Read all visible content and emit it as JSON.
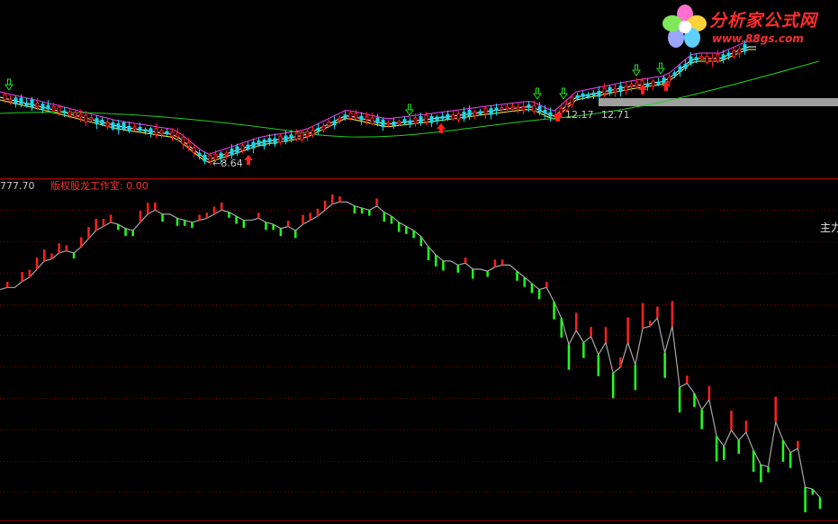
{
  "top_panel": {
    "low_price_label": "←8.64",
    "price_label_a": "12.17",
    "price_label_b": "12.71"
  },
  "bottom_panel": {
    "axis_top_value": "777.70",
    "indicator_title": "版权股龙工作室: 0.00",
    "main_force_label": "主力"
  },
  "logo": {
    "name": "分析家公式网",
    "url": "www.88gs.com"
  },
  "colors": {
    "background": "#000000",
    "up_candle": "#ff2020",
    "down_candle": "#19d8e8",
    "ma_white": "#ffffff",
    "ma_yellow": "#ffff40",
    "ma_magenta": "#ff40ff",
    "ma_green": "#20d020",
    "buy_arrow": "#ff2020",
    "sell_arrow": "#20e020",
    "divider": "#b00000",
    "grid_dot": "#7a0000",
    "indicator_line": "#a8a8a8",
    "indicator_up": "#ff2020",
    "indicator_down": "#20ff20"
  },
  "chart_data": [
    {
      "type": "line",
      "title": "",
      "series": [
        {
          "name": "",
          "values": [
            112,
            113,
            113,
            116,
            118,
            122,
            126,
            127,
            130,
            131,
            130,
            133,
            137,
            141,
            143,
            145,
            144,
            142,
            141,
            145,
            149,
            151,
            149,
            149,
            147,
            146,
            145,
            146,
            147,
            149,
            151,
            150,
            148,
            146,
            146,
            147,
            145,
            144,
            142,
            143,
            141,
            144,
            146,
            148,
            151,
            154,
            155,
            155,
            153,
            152,
            151,
            153,
            150,
            148,
            145,
            143,
            141,
            138,
            133,
            129,
            126,
            126,
            124,
            125,
            122,
            122,
            121,
            123,
            124,
            124,
            121,
            118,
            115,
            112,
            113,
            106,
            98,
            85,
            92,
            86,
            89,
            80,
            86,
            71,
            74,
            86,
            75,
            93,
            94,
            98,
            81,
            94,
            64,
            66,
            61,
            53,
            58,
            40,
            35,
            43,
            38,
            42,
            33,
            26,
            25,
            47,
            38,
            32,
            34,
            15,
            14,
            10
          ]
        }
      ]
    }
  ]
}
